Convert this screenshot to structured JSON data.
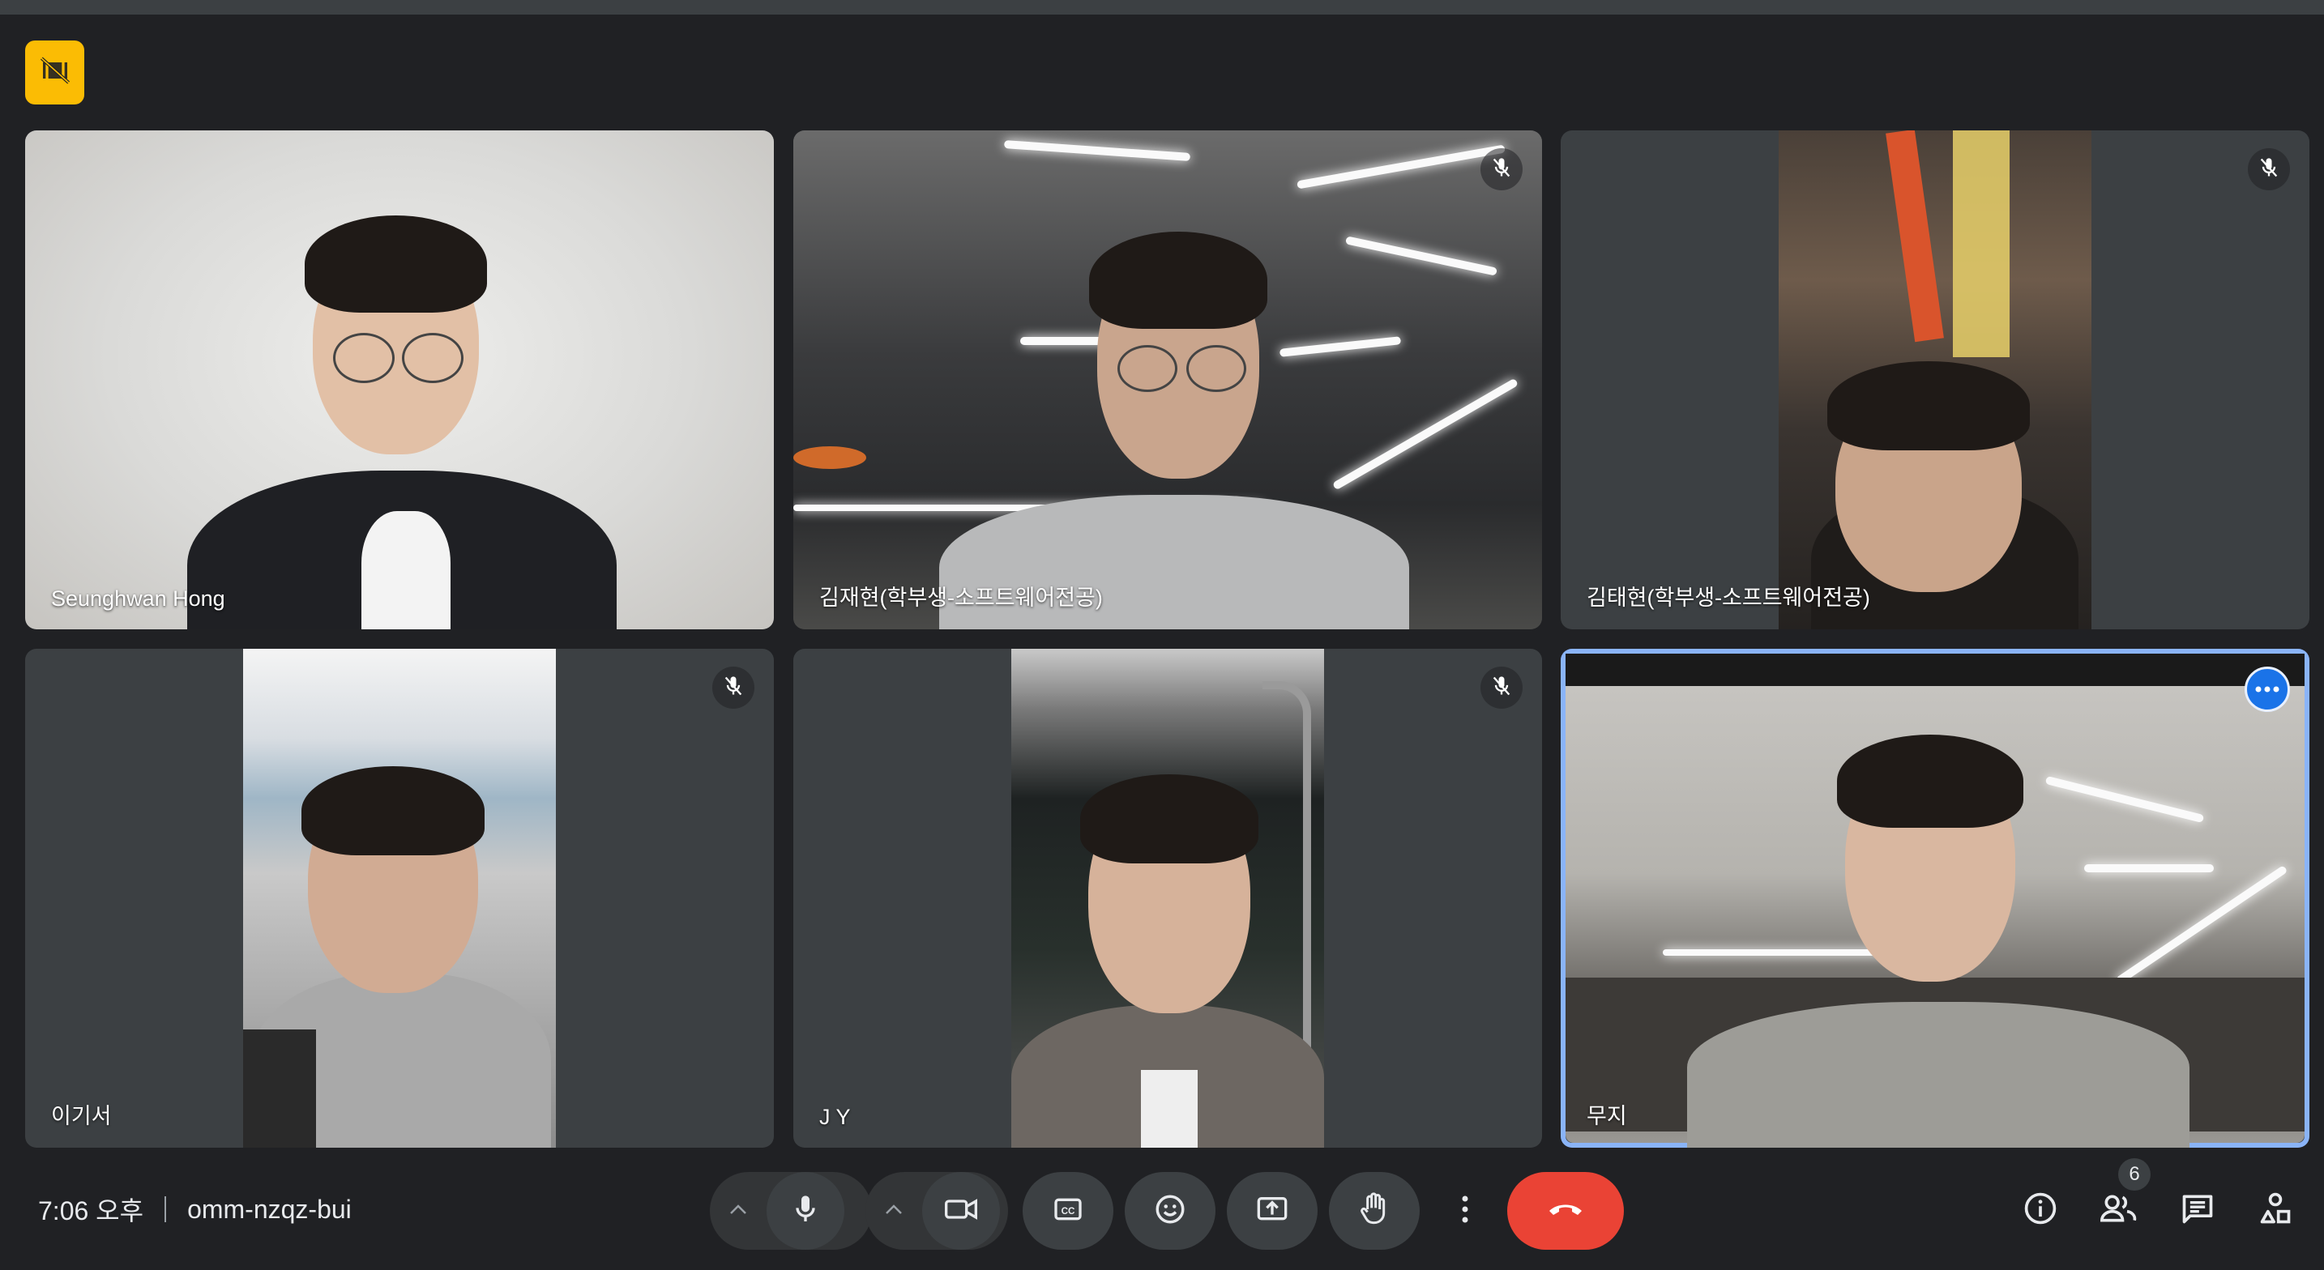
{
  "meeting": {
    "time": "7:06 오후",
    "code": "omm-nzqz-bui"
  },
  "participants": [
    {
      "name": "Seunghwan Hong",
      "muted": false
    },
    {
      "name": "김재현(학부생-소프트웨어전공)",
      "muted": true
    },
    {
      "name": "김태현(학부생-소프트웨어전공)",
      "muted": true
    },
    {
      "name": "이기서",
      "muted": true
    },
    {
      "name": "J Y",
      "muted": true
    },
    {
      "name": "무지",
      "muted": false,
      "active_speaker": true
    }
  ],
  "people_count": "6",
  "colors": {
    "background": "#202124",
    "tile": "#3c4043",
    "end_call": "#ea4335",
    "highlight": "#8ab4f8",
    "accent_icon": "#fbbc04"
  },
  "icons": {
    "top_left": "no-video-grid-icon",
    "mic": "microphone-icon",
    "camera": "camera-icon",
    "captions": "captions-icon",
    "emoji": "emoji-icon",
    "present": "present-screen-icon",
    "hand": "raise-hand-icon",
    "more": "more-vert-icon",
    "end": "end-call-icon",
    "info": "info-icon",
    "people": "people-icon",
    "chat": "chat-icon",
    "activities": "activities-icon"
  }
}
